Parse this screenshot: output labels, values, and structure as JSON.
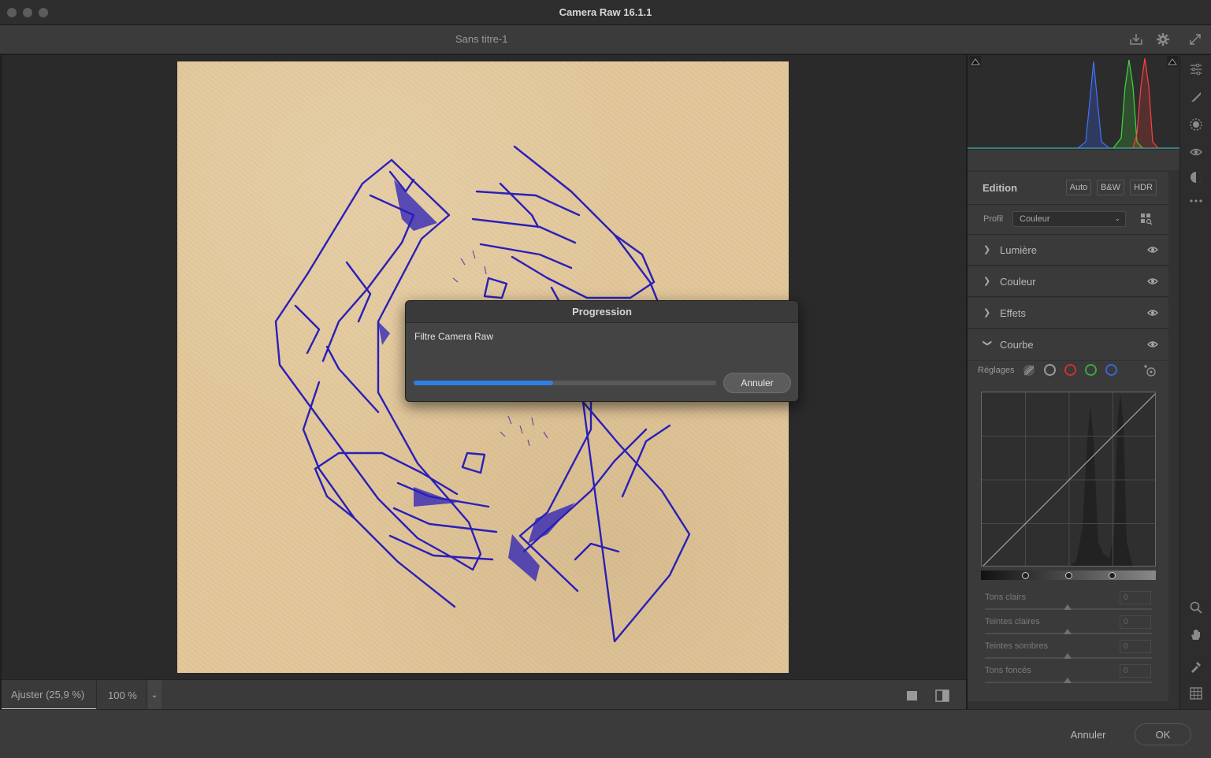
{
  "window": {
    "title": "Camera Raw 16.1.1"
  },
  "document": {
    "title": "Sans titre-1"
  },
  "histogram": {
    "colors": {
      "blue": "#3f74ff",
      "green": "#40d840",
      "red": "#ff4040"
    }
  },
  "edit_panel": {
    "title": "Edition",
    "buttons": [
      "Auto",
      "B&W",
      "HDR"
    ],
    "profile_label": "Profil",
    "profile_value": "Couleur",
    "sections": [
      {
        "label": "Lumière",
        "expanded": false
      },
      {
        "label": "Couleur",
        "expanded": false
      },
      {
        "label": "Effets",
        "expanded": false
      },
      {
        "label": "Courbe",
        "expanded": true
      }
    ],
    "curve": {
      "adjust_label": "Réglages",
      "channel_colors": {
        "rgb": "#9a9a9a",
        "red": "#d03030",
        "green": "#3aa83a",
        "blue": "#3a66d8"
      },
      "sliders": [
        {
          "label": "Tons clairs",
          "value": "0"
        },
        {
          "label": "Teintes claires",
          "value": "0"
        },
        {
          "label": "Teintes sombres",
          "value": "0"
        },
        {
          "label": "Tons foncés",
          "value": "0"
        }
      ]
    }
  },
  "bottom_bar": {
    "fit_label": "Ajuster (25,9 %)",
    "zoom_label": "100 %"
  },
  "footer": {
    "cancel_label": "Annuler",
    "ok_label": "OK"
  },
  "progress_dialog": {
    "title": "Progression",
    "message": "Filtre Camera Raw",
    "progress_fraction": 0.46,
    "cancel_label": "Annuler",
    "accent_color": "#2f7fe0"
  }
}
